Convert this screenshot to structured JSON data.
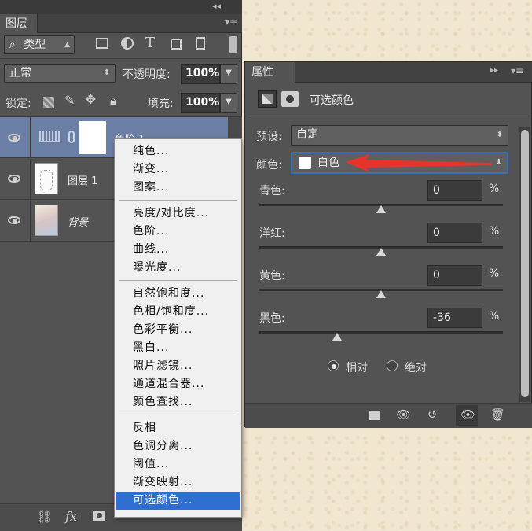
{
  "layers_panel": {
    "tab_label": "图层",
    "filter": {
      "prefix": "⌕",
      "label": "类型"
    },
    "blend_mode": "正常",
    "opacity_label": "不透明度:",
    "opacity_value": "100%",
    "lock_label": "锁定:",
    "fill_label": "填充:",
    "fill_value": "100%",
    "layers": [
      {
        "name": "色阶 1"
      },
      {
        "name": "图层 1"
      },
      {
        "name": "背景"
      }
    ],
    "bottom_icons": [
      "link-icon",
      "fx-icon",
      "mask-icon"
    ],
    "fx_label": "fx"
  },
  "adjustment_menu": {
    "groups": [
      [
        "纯色...",
        "渐变...",
        "图案..."
      ],
      [
        "亮度/对比度...",
        "色阶...",
        "曲线...",
        "曝光度..."
      ],
      [
        "自然饱和度...",
        "色相/饱和度...",
        "色彩平衡...",
        "黑白...",
        "照片滤镜...",
        "通道混合器...",
        "颜色查找..."
      ],
      [
        "反相",
        "色调分离...",
        "阈值...",
        "渐变映射...",
        "可选颜色..."
      ]
    ],
    "selected": "可选颜色..."
  },
  "properties_panel": {
    "tab_label": "属性",
    "title": "可选颜色",
    "preset_label": "预设:",
    "preset_value": "自定",
    "color_label": "颜色:",
    "color_value": "白色",
    "sliders": [
      {
        "label": "青色:",
        "value": "0",
        "unit": "%",
        "level": 0
      },
      {
        "label": "洋红:",
        "value": "0",
        "unit": "%",
        "level": 0
      },
      {
        "label": "黄色:",
        "value": "0",
        "unit": "%",
        "level": 0
      },
      {
        "label": "黑色:",
        "value": "-36",
        "unit": "%",
        "level": -36
      }
    ],
    "mode_options": [
      "相对",
      "绝对"
    ],
    "mode_selected": "相对"
  },
  "colors": {
    "panel_bg": "#535353",
    "menu_highlight": "#2f6fd1",
    "arrow": "#e8322b"
  }
}
